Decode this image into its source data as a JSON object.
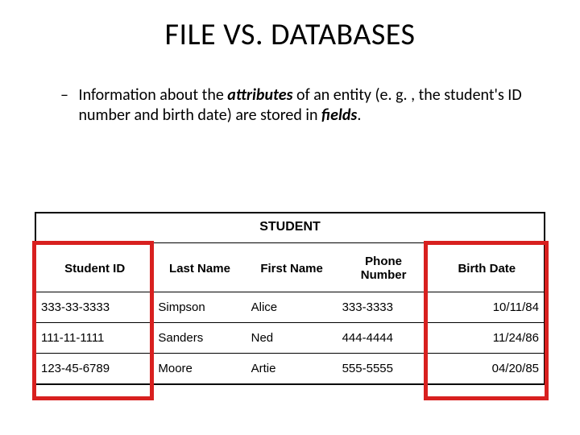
{
  "title": "FILE VS. DATABASES",
  "bullet": {
    "dash": "–",
    "pre": "Information about the ",
    "attr": "attributes",
    "mid1": " of an entity (e. g. , the student's ID number and birth date) are stored in ",
    "fields": "fields",
    "post": "."
  },
  "table": {
    "caption": "STUDENT",
    "headers": {
      "c0": "Student ID",
      "c1": "Last Name",
      "c2": "First Name",
      "c3": "Phone Number",
      "c4": "Birth Date"
    },
    "rows": [
      {
        "c0": "333-33-3333",
        "c1": "Simpson",
        "c2": "Alice",
        "c3": "333-3333",
        "c4": "10/11/84"
      },
      {
        "c0": "111-11-1111",
        "c1": "Sanders",
        "c2": "Ned",
        "c3": "444-4444",
        "c4": "11/24/86"
      },
      {
        "c0": "123-45-6789",
        "c1": "Moore",
        "c2": "Artie",
        "c3": "555-5555",
        "c4": "04/20/85"
      }
    ]
  }
}
